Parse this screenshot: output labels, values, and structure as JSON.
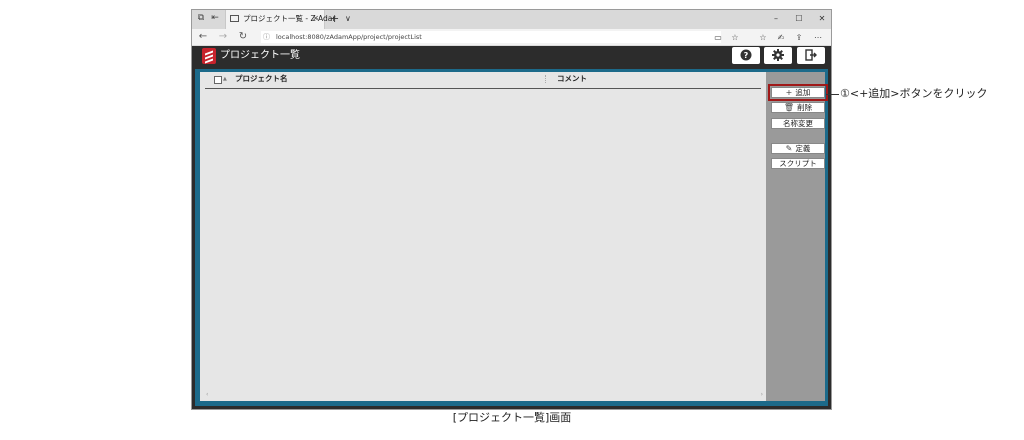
{
  "browser": {
    "tab_title": "プロジェクト一覧 - Z-Adar",
    "tab_close": "✕",
    "new_tab": "+",
    "tab_menu": "∨",
    "url": "localhost:8080/zAdamApp/project/projectList",
    "window_controls": {
      "minimize": "–",
      "maximize": "☐",
      "close": "✕"
    },
    "nav": {
      "back": "←",
      "forward": "→",
      "refresh": "↻"
    }
  },
  "app": {
    "title": "プロジェクト一覧",
    "header_buttons": [
      "help-icon",
      "gear-icon",
      "logout-icon"
    ]
  },
  "list": {
    "columns": [
      {
        "label": "プロジェクト名"
      },
      {
        "label": "コメント"
      }
    ],
    "rows": []
  },
  "side_buttons": {
    "add": {
      "icon": "+",
      "label": "追加"
    },
    "delete": {
      "icon": "🗑",
      "label": "削除"
    },
    "rename": {
      "label": "名称変更"
    },
    "define": {
      "icon": "✎",
      "label": "定義"
    },
    "script": {
      "label": "スクリプト"
    }
  },
  "annotation": {
    "callout": "①<+追加>ボタンをクリック",
    "caption": "[プロジェクト一覧]画面"
  },
  "colors": {
    "accent_frame": "#1c6a8a",
    "header_bg": "#2c2c2c",
    "highlight": "#a01818",
    "logo": "#c8232c"
  }
}
